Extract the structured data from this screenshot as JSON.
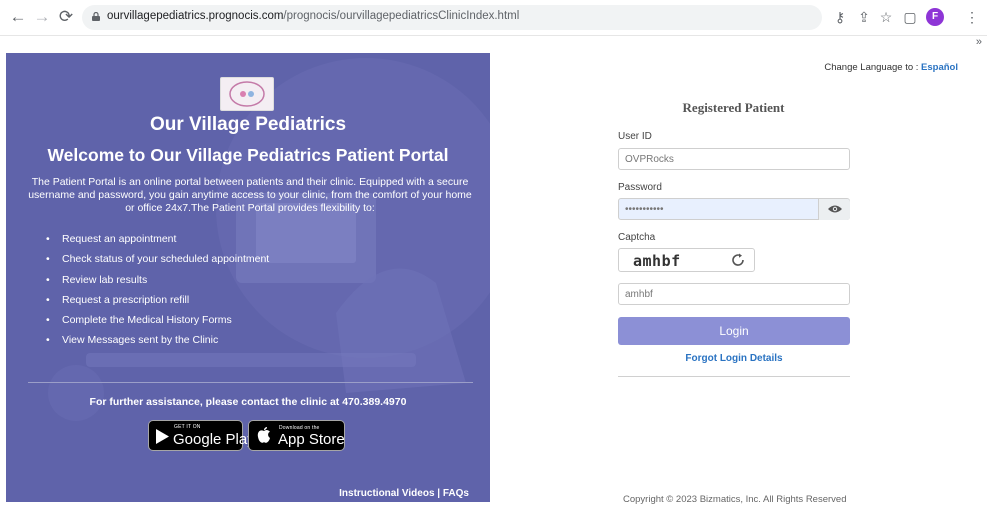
{
  "browser": {
    "url_domain": "ourvillagepediatrics.prognocis.com",
    "url_path": "/prognocis/ourvillagepediatricsClinicIndex.html",
    "profile_initial": "F"
  },
  "left_panel": {
    "clinic_name": "Our Village Pediatrics",
    "welcome": "Welcome to Our Village Pediatrics Patient Portal",
    "intro": "The Patient Portal is an online portal between patients and their clinic. Equipped with a secure username and password, you gain anytime access to your clinic, from the comfort of your home or office 24x7.The Patient Portal provides flexibility to:",
    "features": [
      "Request an appointment",
      "Check status of your scheduled appointment",
      "Review lab results",
      "Request a prescription refill",
      "Complete the Medical History Forms",
      "View Messages sent by the Clinic"
    ],
    "assistance": "For further assistance, please contact the clinic at 470.389.4970",
    "google_play": {
      "small": "GET IT ON",
      "big": "Google Play"
    },
    "app_store": {
      "small": "Download on the",
      "big": "App Store"
    },
    "footer_links": "Instructional Videos | FAQs",
    "background_color": "#5f63aa"
  },
  "right_panel": {
    "change_language_label": "Change Language to :",
    "change_language_link": "Español",
    "form_title": "Registered Patient",
    "user_id_label": "User ID",
    "user_id_value": "OVPRocks",
    "password_label": "Password",
    "password_value": "•••••••••••",
    "captcha_label": "Captcha",
    "captcha_image_text": "amhbf",
    "captcha_value": "amhbf",
    "login_label": "Login",
    "forgot_label": "Forgot Login Details",
    "copyright": "Copyright © 2023 Bizmatics, Inc. All Rights Reserved",
    "accent_color": "#8c90d6",
    "link_color": "#2a73c2"
  }
}
